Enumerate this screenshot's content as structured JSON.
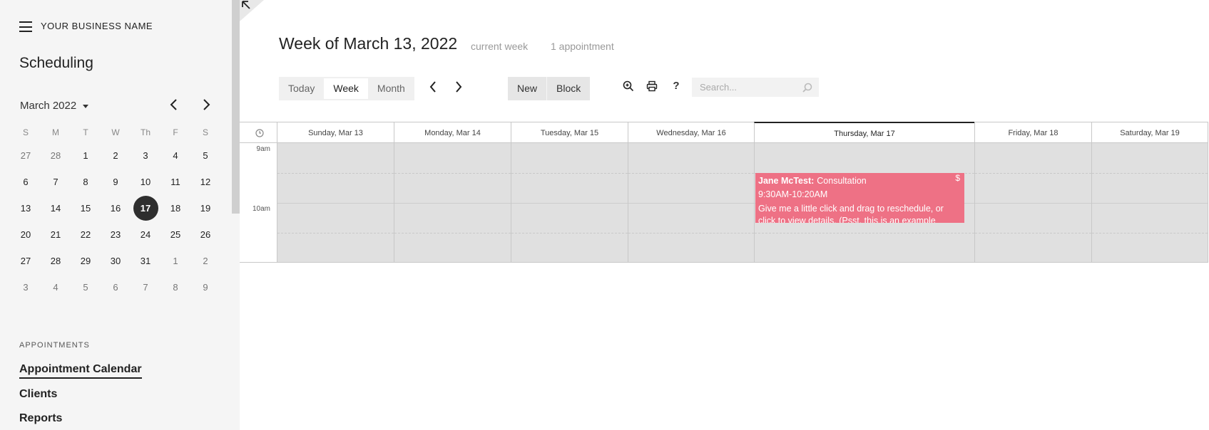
{
  "sidebar": {
    "business_name": "YOUR BUSINESS NAME",
    "title": "Scheduling",
    "month_label": "March 2022",
    "weekday_headers": [
      "S",
      "M",
      "T",
      "W",
      "Th",
      "F",
      "S"
    ],
    "weeks": [
      [
        "27",
        "28",
        "1",
        "2",
        "3",
        "4",
        "5"
      ],
      [
        "6",
        "7",
        "8",
        "9",
        "10",
        "11",
        "12"
      ],
      [
        "13",
        "14",
        "15",
        "16",
        "17",
        "18",
        "19"
      ],
      [
        "20",
        "21",
        "22",
        "23",
        "24",
        "25",
        "26"
      ],
      [
        "27",
        "28",
        "29",
        "30",
        "31",
        "1",
        "2"
      ],
      [
        "3",
        "4",
        "5",
        "6",
        "7",
        "8",
        "9"
      ]
    ],
    "today": "17",
    "appointments_heading": "APPOINTMENTS",
    "nav": [
      {
        "label": "Appointment Calendar",
        "active": true
      },
      {
        "label": "Clients",
        "active": false
      },
      {
        "label": "Reports",
        "active": false
      }
    ]
  },
  "header": {
    "title": "Week of March 13, 2022",
    "current_week": "current week",
    "appointment_count": "1 appointment"
  },
  "toolbar": {
    "views": [
      "Today",
      "Week",
      "Month"
    ],
    "selected_view": "Week",
    "new_label": "New",
    "block_label": "Block",
    "help_label": "?",
    "search_placeholder": "Search..."
  },
  "calendar": {
    "days": [
      "Sunday, Mar 13",
      "Monday, Mar 14",
      "Tuesday, Mar 15",
      "Wednesday, Mar 16",
      "Thursday, Mar 17",
      "Friday, Mar 18",
      "Saturday, Mar 19"
    ],
    "today_index": 4,
    "time_labels": [
      "9am",
      "10am"
    ],
    "event": {
      "client": "Jane McTest:",
      "type": "Consultation",
      "time": "9:30AM-10:20AM",
      "price_symbol": "$",
      "note": "Give me a little click and drag to reschedule, or click to view details. (Psst, this is an example"
    }
  },
  "colors": {
    "event": "#ee7185",
    "today_dot": "#2e2e2e",
    "grid": "#e0e0e0"
  }
}
